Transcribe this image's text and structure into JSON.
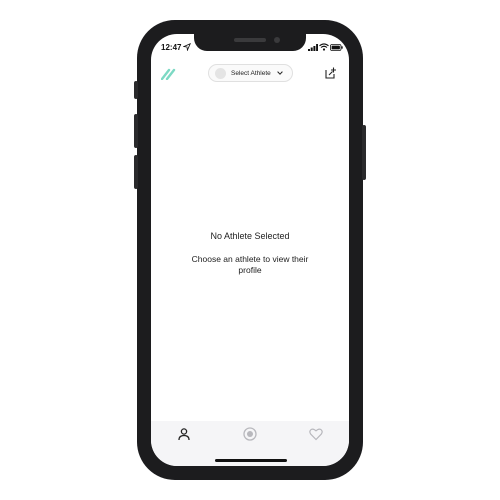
{
  "status_bar": {
    "time": "12:47",
    "icons": [
      "location-arrow-icon",
      "signal-icon",
      "wifi-icon",
      "battery-icon"
    ]
  },
  "header": {
    "logo_icon": "app-logo-icon",
    "athlete_select_label": "Select Athlete",
    "share_icon": "share-icon"
  },
  "empty_state": {
    "title": "No Athlete Selected",
    "message": "Choose an athlete to view their profile"
  },
  "tab_bar": {
    "tabs": [
      {
        "icon": "person-icon",
        "active": true
      },
      {
        "icon": "record-icon",
        "active": false
      },
      {
        "icon": "heart-icon",
        "active": false
      }
    ]
  },
  "colors": {
    "accent": "#7dd9c4",
    "tab_active": "#222222",
    "tab_inactive": "#b8b8bd",
    "tab_bar_bg": "#f5f5f7"
  }
}
